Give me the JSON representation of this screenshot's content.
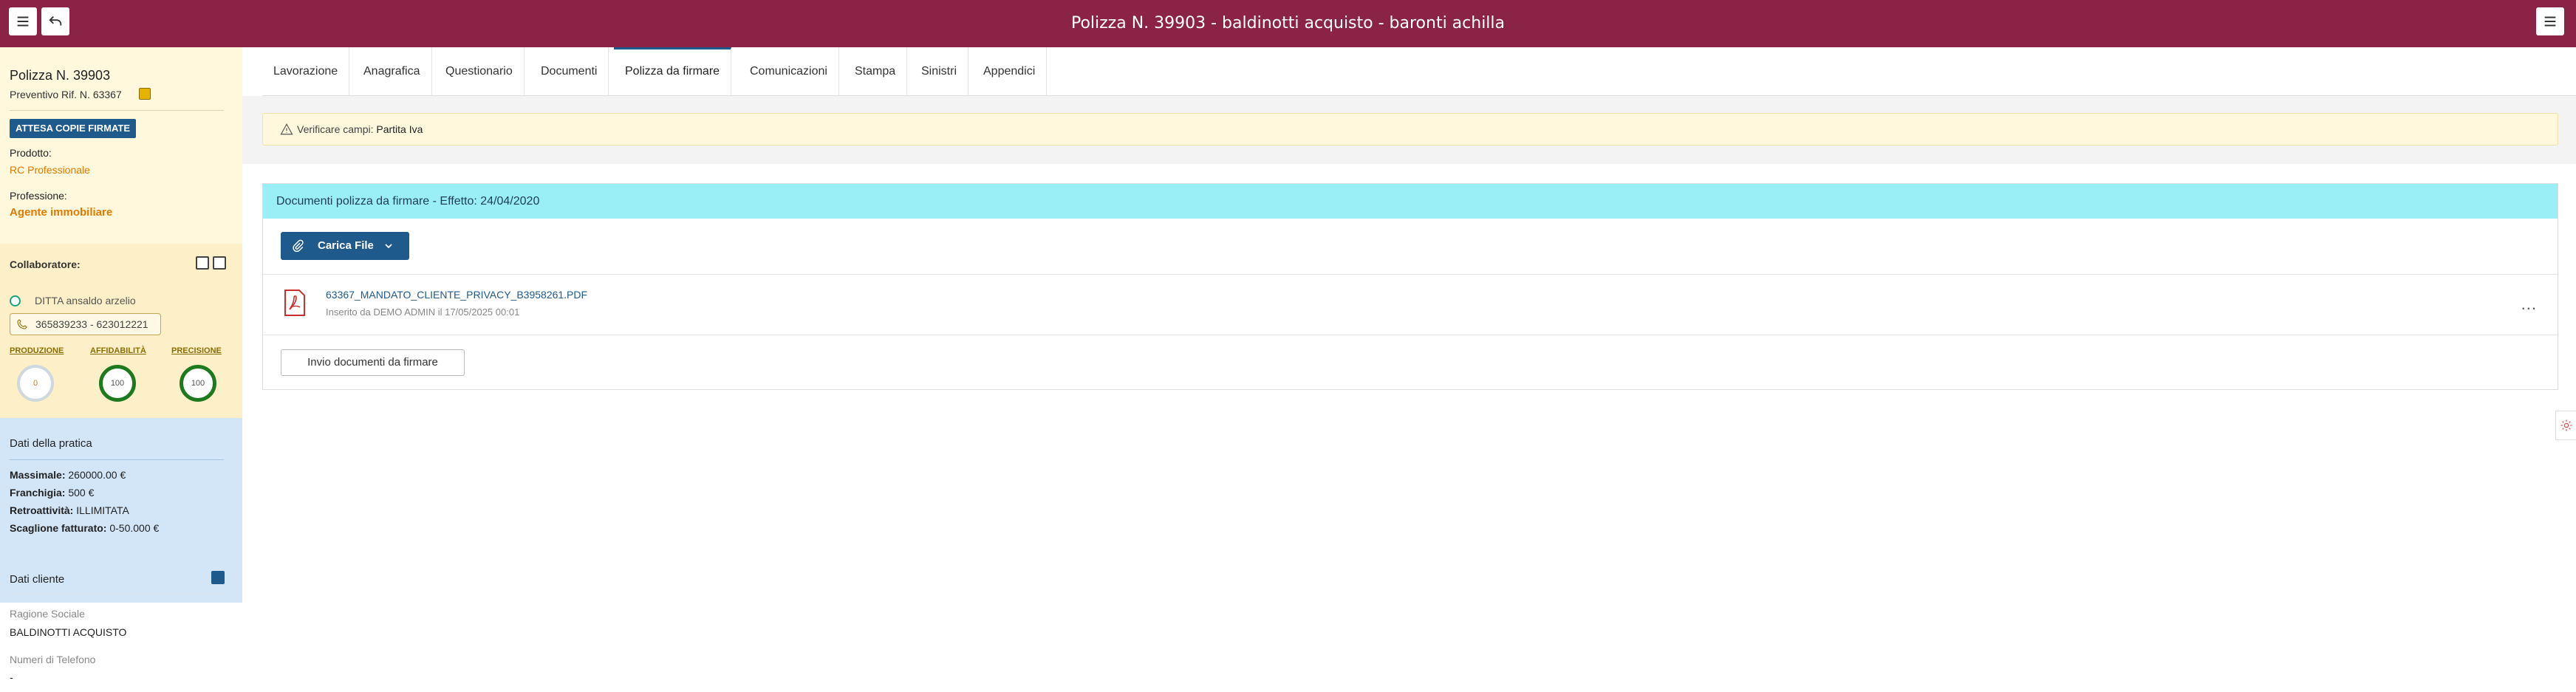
{
  "header": {
    "title": "Polizza N. 39903 - baldinotti acquisto - baronti achilla",
    "menu_icon": "hamburger-icon",
    "back_icon": "back-arrow-icon",
    "right_menu_icon": "hamburger-icon"
  },
  "sidebar": {
    "policy_number": "Polizza N. 39903",
    "preventivo": "Preventivo Rif. N. 63367",
    "status_badge": "ATTESA COPIE FIRMATE",
    "prodotto_label": "Prodotto:",
    "prodotto_value": "RC Professionale",
    "professione_label": "Professione:",
    "professione_value": "Agente immobiliare",
    "collaboratore_label": "Collaboratore:",
    "collaboratore_name": "DITTA ansaldo arzelio",
    "collaboratore_phone": "365839233 - 623012221",
    "metrics": [
      {
        "label": "PRODUZIONE",
        "value": "0"
      },
      {
        "label": "AFFIDABILITÀ",
        "value": "100"
      },
      {
        "label": "PRECISIONE",
        "value": "100"
      }
    ],
    "dati_pratica": {
      "title": "Dati della pratica",
      "rows": [
        {
          "label": "Massimale:",
          "value": " 260000.00 €"
        },
        {
          "label": "Franchigia:",
          "value": " 500 €"
        },
        {
          "label": "Retroattività:",
          "value": " ILLIMITATA"
        },
        {
          "label": "Scaglione fatturato:",
          "value": " 0-50.000 €"
        }
      ]
    },
    "dati_cliente": {
      "title": "Dati cliente",
      "ragione_label": "Ragione Sociale",
      "ragione_value": "BALDINOTTI ACQUISTO",
      "telefono_label": "Numeri di Telefono",
      "telefono_value": "-"
    }
  },
  "tabs": [
    {
      "label": "Lavorazione",
      "active": false
    },
    {
      "label": "Anagrafica",
      "active": false
    },
    {
      "label": "Questionario",
      "active": false
    },
    {
      "label": "Documenti",
      "active": false
    },
    {
      "label": "Polizza da firmare",
      "active": true
    },
    {
      "label": "Comunicazioni",
      "active": false
    },
    {
      "label": "Stampa",
      "active": false
    },
    {
      "label": "Sinistri",
      "active": false
    },
    {
      "label": "Appendici",
      "active": false
    }
  ],
  "alert": {
    "label": "Verificare campi:",
    "field": "Partita Iva"
  },
  "panel": {
    "title": "Documenti polizza da firmare - Effetto: 24/04/2020",
    "upload_button": "Carica File",
    "file": {
      "name": "63367_MANDATO_CLIENTE_PRIVACY_B3958261.PDF",
      "meta": "Inserito da DEMO ADMIN il 17/05/2025 00:01"
    },
    "more_label": "...",
    "send_button": "Invio documenti da firmare"
  },
  "colors": {
    "header": "#8b2346",
    "primary": "#1f5a8c",
    "panel_header": "#9aeef6",
    "orange": "#e07a00"
  }
}
